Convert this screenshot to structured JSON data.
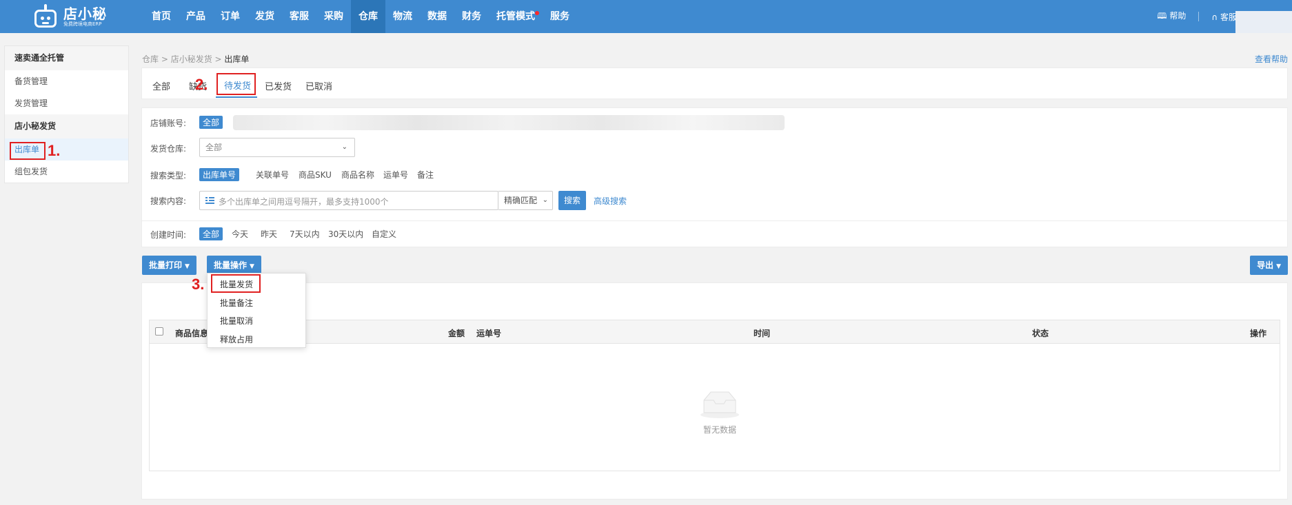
{
  "header": {
    "logo_title": "店小秘",
    "logo_sub": "免费跨境电商ERP",
    "nav": [
      "首页",
      "产品",
      "订单",
      "发货",
      "客服",
      "采购",
      "仓库",
      "物流",
      "数据",
      "财务",
      "托管模式",
      "服务"
    ],
    "nav_active": "仓库",
    "help": "帮助",
    "service": "客服"
  },
  "sidebar": {
    "group1": "速卖通全托管",
    "group1_items": [
      "备货管理",
      "发货管理"
    ],
    "group2": "店小秘发货",
    "group2_items": [
      "出库单",
      "组包发货"
    ]
  },
  "breadcrumb": [
    "仓库",
    "店小秘发货",
    "出库单"
  ],
  "help_link": "查看帮助",
  "tabs": [
    "全部",
    "缺货",
    "待发货",
    "已发货",
    "已取消"
  ],
  "active_tab": "待发货",
  "filters": {
    "shop_label": "店铺账号:",
    "shop_all": "全部",
    "warehouse_label": "发货仓库:",
    "warehouse_value": "全部",
    "search_type_label": "搜索类型:",
    "search_types": [
      "出库单号",
      "关联单号",
      "商品SKU",
      "商品名称",
      "运单号",
      "备注"
    ],
    "search_content_label": "搜索内容:",
    "search_placeholder": "多个出库单之间用逗号隔开，最多支持1000个",
    "match_mode": "精确匹配",
    "search_btn": "搜索",
    "advanced": "高级搜索",
    "time_label": "创建时间:",
    "time_options": [
      "全部",
      "今天",
      "昨天",
      "7天以内",
      "30天以内",
      "自定义"
    ]
  },
  "actions": {
    "batch_print": "批量打印",
    "batch_ops": "批量操作",
    "export": "导出"
  },
  "dropdown_items": [
    "批量发货",
    "批量备注",
    "批量取消",
    "释放占用"
  ],
  "table": {
    "columns": [
      "商品信息",
      "金额",
      "运单号",
      "时间",
      "状态",
      "操作"
    ],
    "empty_text": "暂无数据"
  },
  "markers": [
    "1.",
    "2.",
    "3."
  ],
  "colors": {
    "primary": "#3f8ad0",
    "highlight": "#e02020"
  }
}
